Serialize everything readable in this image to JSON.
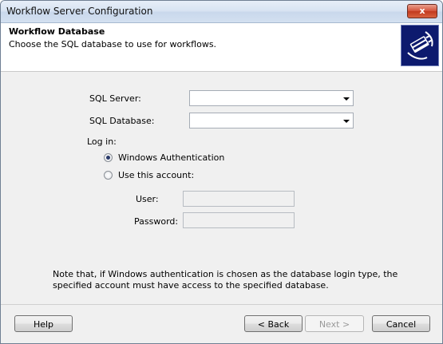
{
  "window": {
    "title": "Workflow Server Configuration",
    "close_label": "x"
  },
  "header": {
    "title": "Workflow Database",
    "subtitle": "Choose the SQL database to use for workflows.",
    "logo_icon": "database-plug-icon"
  },
  "form": {
    "sql_server_label": "SQL Server:",
    "sql_server_value": "",
    "sql_database_label": "SQL Database:",
    "sql_database_value": "",
    "login_label": "Log in:",
    "auth_options": [
      {
        "label": "Windows Authentication",
        "selected": true
      },
      {
        "label": "Use this account:",
        "selected": false
      }
    ],
    "user_label": "User:",
    "user_value": "",
    "password_label": "Password:",
    "password_value": ""
  },
  "note": "Note that, if Windows authentication is chosen as the database login type, the specified account must have access to the specified database.",
  "buttons": {
    "help": "Help",
    "back": "< Back",
    "next": "Next >",
    "cancel": "Cancel"
  },
  "colors": {
    "titlebar": "#d7e3f2",
    "close_button": "#c23a1e",
    "logo_bg": "#0d1a6e",
    "dialog_bg": "#f0f0f0"
  }
}
